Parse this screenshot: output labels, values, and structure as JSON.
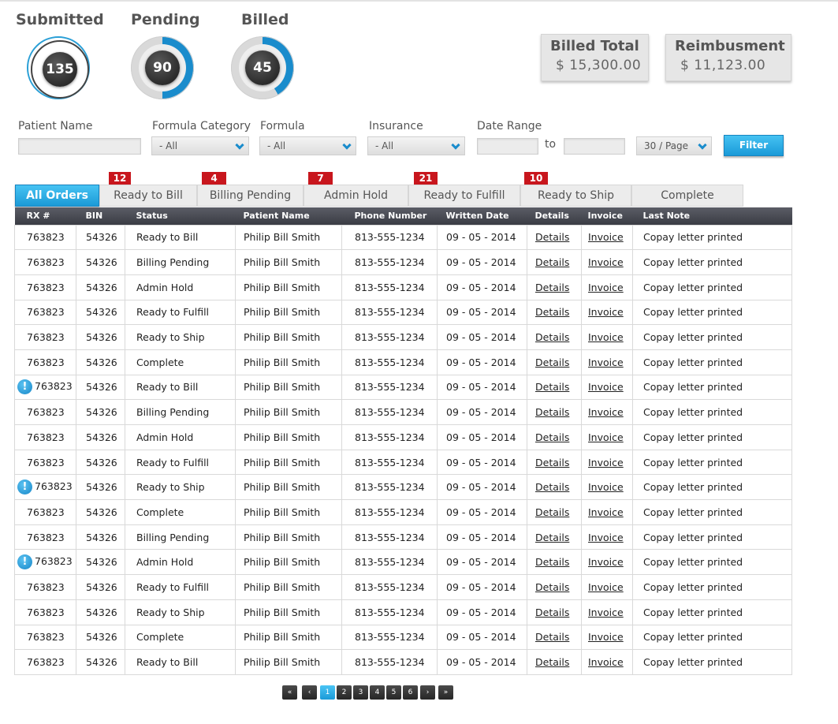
{
  "stats": [
    {
      "label": "Submitted",
      "value": "135",
      "progress_pct": 100
    },
    {
      "label": "Pending",
      "value": "90",
      "progress_pct": 50
    },
    {
      "label": "Billed",
      "value": "45",
      "progress_pct": 42
    }
  ],
  "totals": {
    "billed_label": "Billed Total",
    "billed_value": "$ 15,300.00",
    "reimb_label": "Reimbusment",
    "reimb_value": "$ 11,123.00"
  },
  "filters": {
    "patient_name_label": "Patient Name",
    "patient_name_value": "",
    "formula_category_label": "Formula Category",
    "formula_category_value": "- All",
    "formula_label": "Formula",
    "formula_value": "- All",
    "insurance_label": "Insurance",
    "insurance_value": "- All",
    "date_range_label": "Date Range",
    "date_from": "",
    "to_label": "to",
    "date_to": "",
    "per_page": "30 / Page",
    "filter_button": "Filter"
  },
  "tabs": [
    {
      "label": "All Orders",
      "badge": ""
    },
    {
      "label": "Ready to Bill",
      "badge": "12"
    },
    {
      "label": "Billing Pending",
      "badge": "4"
    },
    {
      "label": "Admin Hold",
      "badge": "7"
    },
    {
      "label": "Ready to Fulfill",
      "badge": "21"
    },
    {
      "label": "Ready to Ship",
      "badge": "10"
    },
    {
      "label": "Complete",
      "badge": ""
    }
  ],
  "table": {
    "headers": [
      "RX #",
      "BIN",
      "Status",
      "Patient Name",
      "Phone Number",
      "Written Date",
      "Details",
      "Invoice",
      "Last Note"
    ],
    "rows": [
      {
        "alert": false,
        "rx": "763823",
        "bin": "54326",
        "status": "Ready to Bill",
        "patient": "Philip Bill Smith",
        "phone": "813-555-1234",
        "date": "09 - 05 - 2014",
        "details": "Details",
        "invoice": "Invoice",
        "note": "Copay letter printed"
      },
      {
        "alert": false,
        "rx": "763823",
        "bin": "54326",
        "status": "Billing Pending",
        "patient": "Philip Bill Smith",
        "phone": "813-555-1234",
        "date": "09 - 05 - 2014",
        "details": "Details",
        "invoice": "Invoice",
        "note": "Copay letter printed"
      },
      {
        "alert": false,
        "rx": "763823",
        "bin": "54326",
        "status": "Admin Hold",
        "patient": "Philip Bill Smith",
        "phone": "813-555-1234",
        "date": "09 - 05 - 2014",
        "details": "Details",
        "invoice": "Invoice",
        "note": "Copay letter printed"
      },
      {
        "alert": false,
        "rx": "763823",
        "bin": "54326",
        "status": "Ready to Fulfill",
        "patient": "Philip Bill Smith",
        "phone": "813-555-1234",
        "date": "09 - 05 - 2014",
        "details": "Details",
        "invoice": "Invoice",
        "note": "Copay letter printed"
      },
      {
        "alert": false,
        "rx": "763823",
        "bin": "54326",
        "status": "Ready to Ship",
        "patient": "Philip Bill Smith",
        "phone": "813-555-1234",
        "date": "09 - 05 - 2014",
        "details": "Details",
        "invoice": "Invoice",
        "note": "Copay letter printed"
      },
      {
        "alert": false,
        "rx": "763823",
        "bin": "54326",
        "status": "Complete",
        "patient": "Philip Bill Smith",
        "phone": "813-555-1234",
        "date": "09 - 05 - 2014",
        "details": "Details",
        "invoice": "Invoice",
        "note": "Copay letter printed"
      },
      {
        "alert": true,
        "rx": "763823",
        "bin": "54326",
        "status": "Ready to Bill",
        "patient": "Philip Bill Smith",
        "phone": "813-555-1234",
        "date": "09 - 05 - 2014",
        "details": "Details",
        "invoice": "Invoice",
        "note": "Copay letter printed"
      },
      {
        "alert": false,
        "rx": "763823",
        "bin": "54326",
        "status": "Billing Pending",
        "patient": "Philip Bill Smith",
        "phone": "813-555-1234",
        "date": "09 - 05 - 2014",
        "details": "Details",
        "invoice": "Invoice",
        "note": "Copay letter printed"
      },
      {
        "alert": false,
        "rx": "763823",
        "bin": "54326",
        "status": "Admin Hold",
        "patient": "Philip Bill Smith",
        "phone": "813-555-1234",
        "date": "09 - 05 - 2014",
        "details": "Details",
        "invoice": "Invoice",
        "note": "Copay letter printed"
      },
      {
        "alert": false,
        "rx": "763823",
        "bin": "54326",
        "status": "Ready to Fulfill",
        "patient": "Philip Bill Smith",
        "phone": "813-555-1234",
        "date": "09 - 05 - 2014",
        "details": "Details",
        "invoice": "Invoice",
        "note": "Copay letter printed"
      },
      {
        "alert": true,
        "rx": "763823",
        "bin": "54326",
        "status": "Ready to Ship",
        "patient": "Philip Bill Smith",
        "phone": "813-555-1234",
        "date": "09 - 05 - 2014",
        "details": "Details",
        "invoice": "Invoice",
        "note": "Copay letter printed"
      },
      {
        "alert": false,
        "rx": "763823",
        "bin": "54326",
        "status": "Complete",
        "patient": "Philip Bill Smith",
        "phone": "813-555-1234",
        "date": "09 - 05 - 2014",
        "details": "Details",
        "invoice": "Invoice",
        "note": "Copay letter printed"
      },
      {
        "alert": false,
        "rx": "763823",
        "bin": "54326",
        "status": "Billing Pending",
        "patient": "Philip Bill Smith",
        "phone": "813-555-1234",
        "date": "09 - 05 - 2014",
        "details": "Details",
        "invoice": "Invoice",
        "note": "Copay letter printed"
      },
      {
        "alert": true,
        "rx": "763823",
        "bin": "54326",
        "status": "Admin Hold",
        "patient": "Philip Bill Smith",
        "phone": "813-555-1234",
        "date": "09 - 05 - 2014",
        "details": "Details",
        "invoice": "Invoice",
        "note": "Copay letter printed"
      },
      {
        "alert": false,
        "rx": "763823",
        "bin": "54326",
        "status": "Ready to Fulfill",
        "patient": "Philip Bill Smith",
        "phone": "813-555-1234",
        "date": "09 - 05 - 2014",
        "details": "Details",
        "invoice": "Invoice",
        "note": "Copay letter printed"
      },
      {
        "alert": false,
        "rx": "763823",
        "bin": "54326",
        "status": "Ready to Ship",
        "patient": "Philip Bill Smith",
        "phone": "813-555-1234",
        "date": "09 - 05 - 2014",
        "details": "Details",
        "invoice": "Invoice",
        "note": "Copay letter printed"
      },
      {
        "alert": false,
        "rx": "763823",
        "bin": "54326",
        "status": "Complete",
        "patient": "Philip Bill Smith",
        "phone": "813-555-1234",
        "date": "09 - 05 - 2014",
        "details": "Details",
        "invoice": "Invoice",
        "note": "Copay letter printed"
      },
      {
        "alert": false,
        "rx": "763823",
        "bin": "54326",
        "status": "Ready to Bill",
        "patient": "Philip Bill Smith",
        "phone": "813-555-1234",
        "date": "09 - 05 - 2014",
        "details": "Details",
        "invoice": "Invoice",
        "note": "Copay letter printed"
      }
    ]
  },
  "pager": {
    "first": "«",
    "prev": "‹",
    "pages": [
      "1",
      "2",
      "3",
      "4",
      "5",
      "6"
    ],
    "current": "1",
    "next": "›",
    "last": "»"
  },
  "colors": {
    "accent": "#1a9ad8",
    "badge": "#c8161d",
    "header": "#3a3c44"
  }
}
